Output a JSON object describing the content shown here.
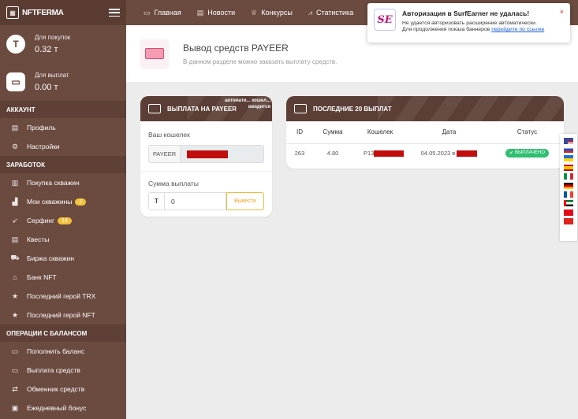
{
  "brand": {
    "name": "NFTFERMA"
  },
  "balances": [
    {
      "label": "Для покупок",
      "value": "0.32 т"
    },
    {
      "label": "Для выплат",
      "value": "0.00 т"
    }
  ],
  "sidebar": {
    "sections": [
      {
        "title": "АККАУНТ",
        "items": [
          {
            "label": "Профиль",
            "icon": "doc-icon"
          },
          {
            "label": "Настройки",
            "icon": "gear-icon"
          }
        ]
      },
      {
        "title": "ЗАРАБОТОК",
        "items": [
          {
            "label": "Покупка скважин",
            "icon": "building-icon"
          },
          {
            "label": "Мои скважины",
            "icon": "chart-icon",
            "badge": "2"
          },
          {
            "label": "Серфинг",
            "icon": "rocket-icon",
            "badge": "14"
          },
          {
            "label": "Квесты",
            "icon": "doc-icon"
          },
          {
            "label": "Биржа скважин",
            "icon": "cart-icon"
          },
          {
            "label": "Банк NFT",
            "icon": "bank-icon"
          },
          {
            "label": "Последний герой TRX",
            "icon": "star-icon"
          },
          {
            "label": "Последний герой NFT",
            "icon": "star-icon"
          }
        ]
      },
      {
        "title": "ОПЕРАЦИИ С БАЛАНСОМ",
        "items": [
          {
            "label": "Пополнить баланс",
            "icon": "wallet-icon"
          },
          {
            "label": "Выплата средств",
            "icon": "wallet-icon"
          },
          {
            "label": "Обменник средств",
            "icon": "exchange-icon"
          },
          {
            "label": "Ежедневный бонус",
            "icon": "gift-icon"
          }
        ]
      }
    ]
  },
  "topnav": [
    {
      "label": "Главная",
      "icon": "monitor-icon"
    },
    {
      "label": "Новости",
      "icon": "news-icon"
    },
    {
      "label": "Конкурсы",
      "icon": "trophy-icon"
    },
    {
      "label": "Статистика",
      "icon": "stats-icon"
    }
  ],
  "header": {
    "title": "Вывод средств PAYEER",
    "subtitle": "В данном разделе можно заказать выплату средств."
  },
  "payout_card": {
    "title": "ВЫПЛАТА НА PAYEER",
    "auto_note": "автомати... кошел... вводится",
    "wallet_label": "Ваш кошелек",
    "wallet_prefix": "PAYEER",
    "sum_label": "Сумма выплаты",
    "sum_prefix": "T",
    "sum_value": "0",
    "submit_label": "Вывести"
  },
  "payouts_card": {
    "title": "ПОСЛЕДНИЕ 20 ВЫПЛАТ",
    "columns": [
      "ID",
      "Сумма",
      "Кошелек",
      "Дата",
      "Статус"
    ],
    "rows": [
      {
        "id": "263",
        "sum": "4.80",
        "wallet": "P13",
        "date": "04.05.2023 в",
        "status": "ВЫПЛАЧЕНО"
      }
    ]
  },
  "popup": {
    "logo": "SE",
    "title": "Авторизация в SurfEarner не удалась!",
    "text1": "Не удается авторизовать расширение автоматически.",
    "text2": "Для продолжения показа баннеров",
    "link": "перейдите по ссылке",
    "close": "×"
  },
  "colors": {
    "sidebar": "#6b4a3f",
    "accent": "#f0b93e",
    "success": "#2fbf71",
    "popup_link": "#1a5fd6"
  }
}
